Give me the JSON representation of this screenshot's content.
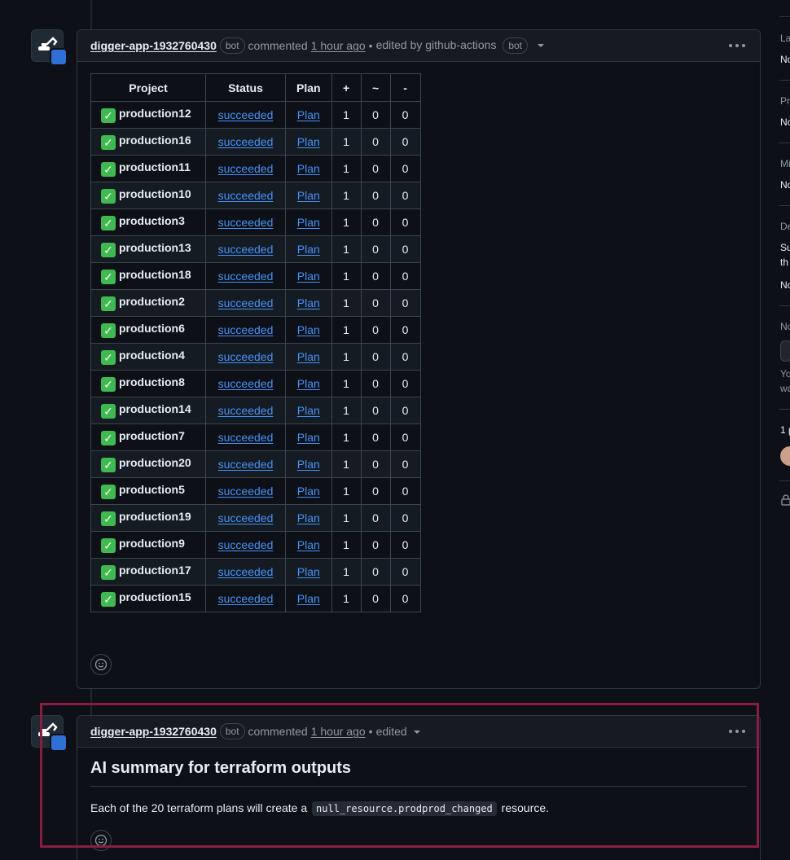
{
  "comments": [
    {
      "author": "digger-app-1932760430",
      "bot_label": "bot",
      "action": "commented",
      "time": "1 hour ago",
      "separator": "•",
      "edited_text": "edited by github-actions",
      "edited_bot_label": "bot",
      "table": {
        "headers": [
          "Project",
          "Status",
          "Plan",
          "+",
          "~",
          "-"
        ],
        "rows": [
          [
            "production12",
            "succeeded",
            "Plan",
            "1",
            "0",
            "0"
          ],
          [
            "production16",
            "succeeded",
            "Plan",
            "1",
            "0",
            "0"
          ],
          [
            "production11",
            "succeeded",
            "Plan",
            "1",
            "0",
            "0"
          ],
          [
            "production10",
            "succeeded",
            "Plan",
            "1",
            "0",
            "0"
          ],
          [
            "production3",
            "succeeded",
            "Plan",
            "1",
            "0",
            "0"
          ],
          [
            "production13",
            "succeeded",
            "Plan",
            "1",
            "0",
            "0"
          ],
          [
            "production18",
            "succeeded",
            "Plan",
            "1",
            "0",
            "0"
          ],
          [
            "production2",
            "succeeded",
            "Plan",
            "1",
            "0",
            "0"
          ],
          [
            "production6",
            "succeeded",
            "Plan",
            "1",
            "0",
            "0"
          ],
          [
            "production4",
            "succeeded",
            "Plan",
            "1",
            "0",
            "0"
          ],
          [
            "production8",
            "succeeded",
            "Plan",
            "1",
            "0",
            "0"
          ],
          [
            "production14",
            "succeeded",
            "Plan",
            "1",
            "0",
            "0"
          ],
          [
            "production7",
            "succeeded",
            "Plan",
            "1",
            "0",
            "0"
          ],
          [
            "production20",
            "succeeded",
            "Plan",
            "1",
            "0",
            "0"
          ],
          [
            "production5",
            "succeeded",
            "Plan",
            "1",
            "0",
            "0"
          ],
          [
            "production19",
            "succeeded",
            "Plan",
            "1",
            "0",
            "0"
          ],
          [
            "production9",
            "succeeded",
            "Plan",
            "1",
            "0",
            "0"
          ],
          [
            "production17",
            "succeeded",
            "Plan",
            "1",
            "0",
            "0"
          ],
          [
            "production15",
            "succeeded",
            "Plan",
            "1",
            "0",
            "0"
          ]
        ]
      }
    },
    {
      "author": "digger-app-1932760430",
      "bot_label": "bot",
      "action": "commented",
      "time": "1 hour ago",
      "separator": "•",
      "edited_text": "edited",
      "heading": "AI summary for terraform outputs",
      "body_before": "Each of the 20 terraform plans will create a",
      "body_code": "null_resource.prodprod_changed",
      "body_after": "resource."
    }
  ],
  "icons": {
    "status_check": "white-check-mark-emoji",
    "reaction": "smiley-icon",
    "menu": "kebab-horizontal-icon",
    "avatar": "digger-excavator-icon"
  },
  "sidebar_fragments": [
    "La",
    "No",
    "Pr",
    "No",
    "Mi",
    "No",
    "De",
    "Su",
    "th",
    "No",
    "No",
    "Yo",
    "wa",
    "1 p"
  ],
  "colors": {
    "background": "#0d1117",
    "link": "#4493f8",
    "check": "#3fb950",
    "highlight_border": "#8b1c3f"
  }
}
